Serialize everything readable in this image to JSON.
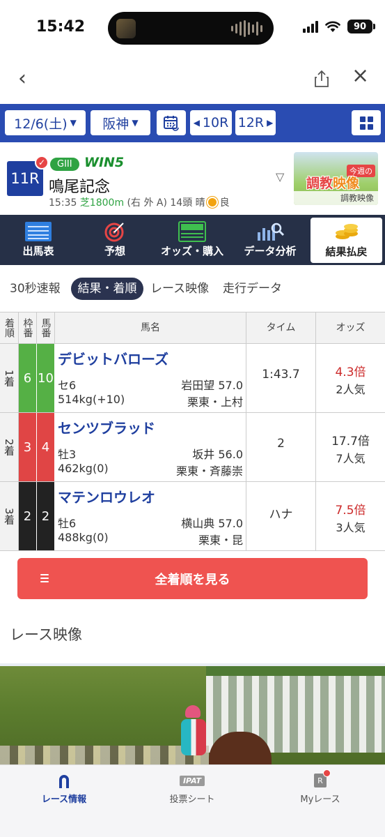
{
  "status": {
    "time": "15:42",
    "battery": "90"
  },
  "browser": {
    "back": "‹",
    "close": "×"
  },
  "filter": {
    "date": "12/6(土)",
    "place": "阪神",
    "prev_race": "10R",
    "next_race": "12R"
  },
  "race": {
    "number": "11R",
    "grade": "GIII",
    "win5": "WIN5",
    "name": "鳴尾記念",
    "start_time": "15:35",
    "course": "芝1800m",
    "course_detail": "(右 外 A) 14頭 晴",
    "going": "良",
    "video_tag": "今週の",
    "video_title_a": "調",
    "video_title_b": "教",
    "video_title_c": "映像",
    "video_label": "調教映像"
  },
  "menu": [
    {
      "label": "出馬表",
      "icon": "entries-icon"
    },
    {
      "label": "予想",
      "icon": "target-icon"
    },
    {
      "label": "オッズ・購入",
      "icon": "ipat-icon"
    },
    {
      "label": "データ分析",
      "icon": "chart-search-icon"
    },
    {
      "label": "結果払戻",
      "icon": "coins-icon"
    }
  ],
  "subtabs": [
    "30秒速報",
    "結果・着順",
    "レース映像",
    "走行データ"
  ],
  "table": {
    "headers": {
      "rank": "着順",
      "frame": "枠番",
      "number": "馬番",
      "name": "馬名",
      "time": "タイム",
      "odds": "オッズ"
    },
    "rows": [
      {
        "rank": "1着",
        "frame": "6",
        "number": "10",
        "frame_color": "green",
        "horse": "デビットバローズ",
        "sex_age": "セ6",
        "jockey": "岩田望 57.0",
        "weight": "514kg(+10)",
        "trainer": "栗東・上村",
        "time": "1:43.7",
        "odds": "4.3倍",
        "popularity": "2人気",
        "odds_hot": true
      },
      {
        "rank": "2着",
        "frame": "3",
        "number": "4",
        "frame_color": "red",
        "horse": "センツブラッド",
        "sex_age": "牡3",
        "jockey": "坂井 56.0",
        "weight": "462kg(0)",
        "trainer": "栗東・斉藤崇",
        "time": "2",
        "odds": "17.7倍",
        "popularity": "7人気",
        "odds_hot": false
      },
      {
        "rank": "3着",
        "frame": "2",
        "number": "2",
        "frame_color": "black",
        "horse": "マテンロウレオ",
        "sex_age": "牡6",
        "jockey": "横山典 57.0",
        "weight": "488kg(0)",
        "trainer": "栗東・昆",
        "time": "ハナ",
        "odds": "7.5倍",
        "popularity": "3人気",
        "odds_hot": true
      }
    ]
  },
  "all_results_button": "全着順を見る",
  "video_section_title": "レース映像",
  "tabbar": [
    {
      "label": "レース情報",
      "icon": "horseshoe-icon",
      "active": true
    },
    {
      "label": "投票シート",
      "icon": "ipat-icon",
      "icon_text": "IPAT",
      "active": false
    },
    {
      "label": "Myレース",
      "icon": "my-race-icon",
      "icon_text": "R",
      "active": false
    }
  ],
  "colors": {
    "accent": "#2a4cb2",
    "menu_bg": "#263047",
    "button": "#ef5350",
    "hot_odds": "#cc2a2a"
  }
}
